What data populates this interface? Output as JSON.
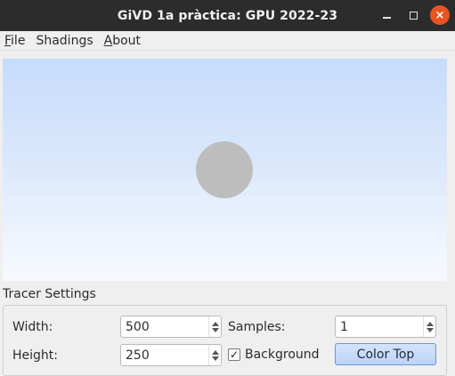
{
  "window": {
    "title": "GiVD 1a pràctica: GPU 2022-23",
    "minimize_icon": "minimize-icon",
    "maximize_icon": "maximize-icon",
    "close_icon": "close-icon",
    "close_glyph": "×"
  },
  "menu": {
    "file": {
      "mnemonic": "F",
      "rest": "ile"
    },
    "shadings": {
      "label": "Shadings"
    },
    "about": {
      "mnemonic": "A",
      "rest": "bout"
    }
  },
  "viewport": {
    "background_top": "#c6dcfb",
    "background_bottom": "#f6f9fe",
    "sphere_color": "#bdbdbd"
  },
  "tracer_settings": {
    "title": "Tracer Settings",
    "width_label": "Width:",
    "width_value": "500",
    "height_label": "Height:",
    "height_value": "250",
    "samples_label": "Samples:",
    "samples_value": "1",
    "background_label": "Background",
    "background_checked": "✓",
    "color_top_button": "Color Top"
  }
}
